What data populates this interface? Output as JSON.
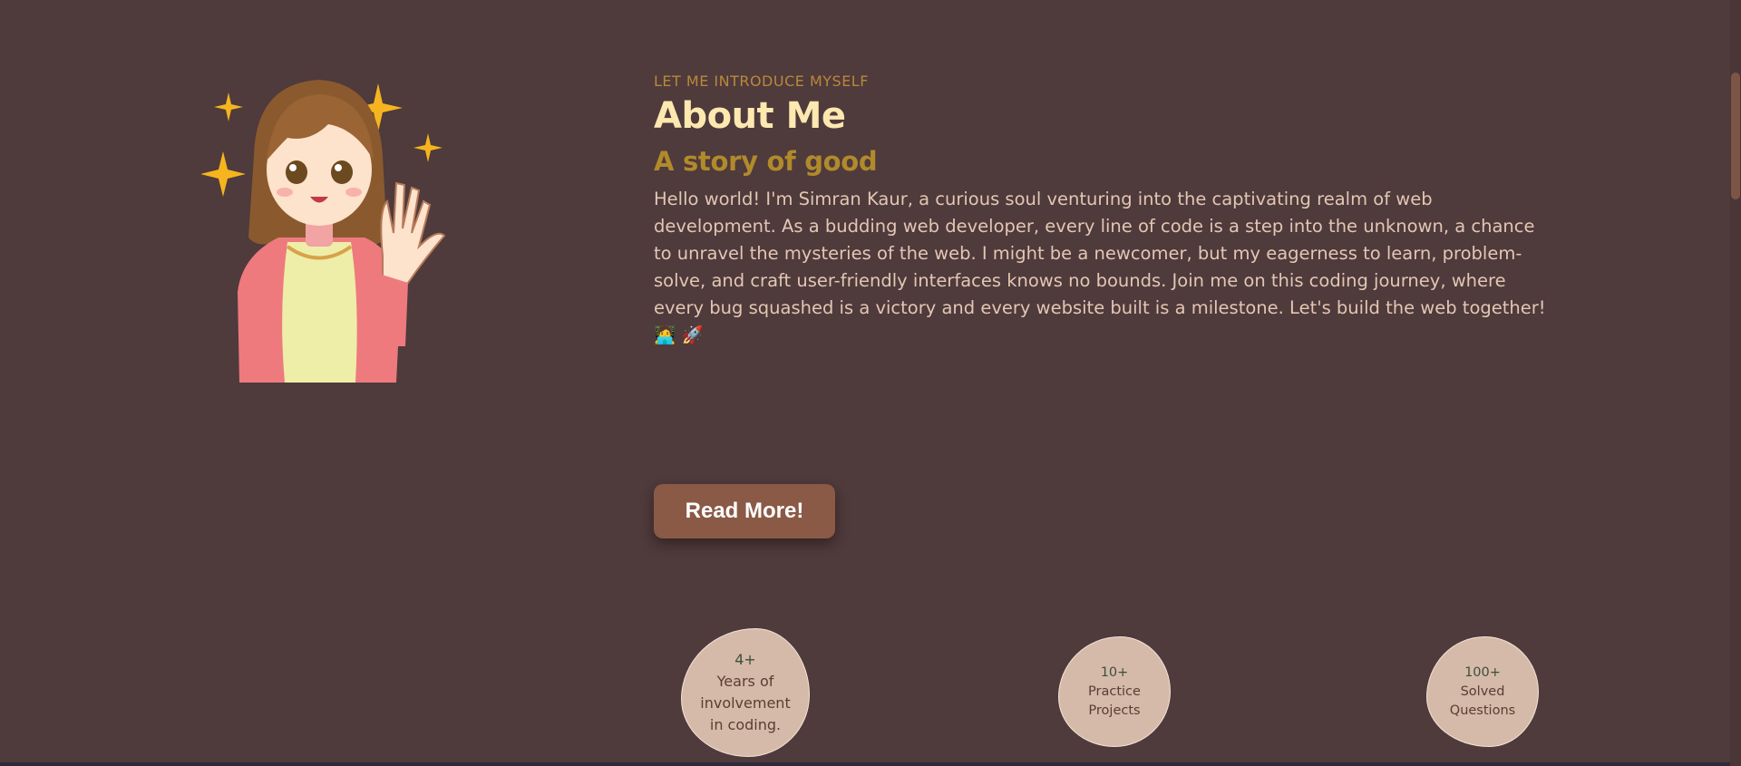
{
  "about": {
    "kicker": "LET ME INTRODUCE MYSELF",
    "title": "About Me",
    "subtitle": "A story of good",
    "paragraph": "Hello world! I'm Simran Kaur, a curious soul venturing into the captivating realm of web development. As a budding web developer, every line of code is a step into the unknown, a chance to unravel the mysteries of the web. I might be a newcomer, but my eagerness to learn, problem-solve, and craft user-friendly interfaces knows no bounds. Join me on this coding journey, where every bug squashed is a victory and every website built is a milestone. Let's build the web together! 🧑‍💻 🚀",
    "read_more_label": "Read More!"
  },
  "stats": [
    {
      "value": "4+",
      "label_lines": [
        "Years of",
        "involvement",
        "in coding."
      ]
    },
    {
      "value": "10+",
      "label_lines": [
        "Practice",
        "Projects"
      ]
    },
    {
      "value": "100+",
      "label_lines": [
        "Solved",
        "Questions"
      ]
    }
  ],
  "colors": {
    "background": "#4f3a3c",
    "accent": "#b08a2b",
    "heading": "#fde8b0",
    "button": "#8a5a46",
    "stat_blob": "#d6baa9"
  },
  "icons": {
    "avatar": "waving-girl-illustration",
    "sparkles": "sparkle-icon"
  }
}
